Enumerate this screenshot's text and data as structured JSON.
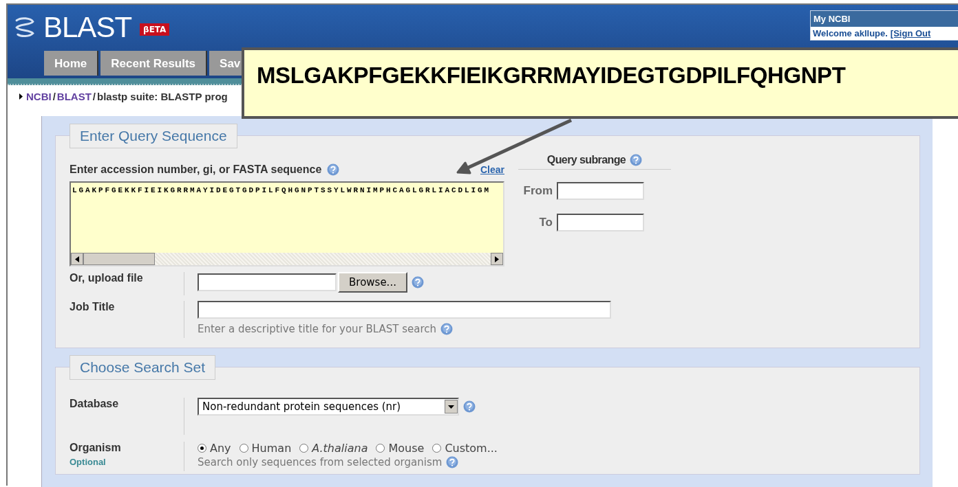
{
  "header": {
    "logo": "BLAST",
    "badge": "βETA",
    "tabs": [
      {
        "label": "Home",
        "selected": false
      },
      {
        "label": "Recent Results",
        "selected": false
      },
      {
        "label": "Sav",
        "selected": false
      }
    ],
    "account": {
      "title": "My NCBI",
      "welcome": "Welcome akllupe.",
      "sign_out": "[Sign Out"
    }
  },
  "breadcrumb": [
    {
      "text": "NCBI",
      "kind": "link"
    },
    {
      "text": "/",
      "kind": "separator"
    },
    {
      "text": "BLAST",
      "kind": "link"
    },
    {
      "text": "/",
      "kind": "separator"
    },
    {
      "text": "blastp suite: BLASTP prog",
      "kind": "current"
    }
  ],
  "callout": {
    "text": "MSLGAKPFGEKKFIEIKGRRMAYIDEGTGDPILFQHGNPT"
  },
  "query": {
    "legend": "Enter Query Sequence",
    "label": "Enter accession number, gi, or FASTA sequence",
    "clear": "Clear",
    "sequence": "LGAKPFGEKKFIEIKGRRMAYIDEGTGDPILFQHGNPTSSYLWRNIMPHCAGLGRLIACDLIGM",
    "subrange": {
      "title": "Query subrange",
      "from": "From",
      "to": "To"
    },
    "upload": {
      "label": "Or, upload file",
      "button": "Browse..."
    },
    "job_title": {
      "label": "Job Title",
      "hint": "Enter a descriptive title for your BLAST search"
    }
  },
  "search_set": {
    "legend": "Choose Search Set",
    "database": {
      "label": "Database",
      "value": "Non-redundant protein sequences (nr)"
    },
    "organism": {
      "label": "Organism",
      "note": "Optional",
      "options": [
        {
          "label": "Any",
          "selected": true,
          "italic": false
        },
        {
          "label": "Human",
          "selected": false,
          "italic": false
        },
        {
          "label": "A.thaliana",
          "selected": false,
          "italic": true
        },
        {
          "label": "Mouse",
          "selected": false,
          "italic": false
        },
        {
          "label": "Custom...",
          "selected": false,
          "italic": false
        }
      ],
      "hint": "Search only sequences from selected organism"
    }
  }
}
